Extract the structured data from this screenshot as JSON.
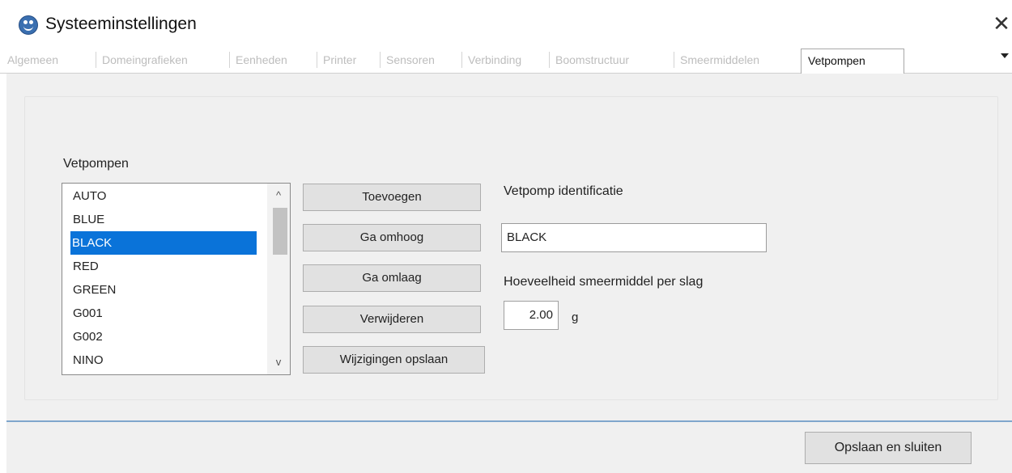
{
  "window": {
    "title": "Systeeminstellingen",
    "close_label": "✕"
  },
  "tabs": [
    {
      "label": "Algemeen"
    },
    {
      "label": "Domeingrafieken"
    },
    {
      "label": "Eenheden"
    },
    {
      "label": "Printer"
    },
    {
      "label": "Sensoren"
    },
    {
      "label": "Verbinding"
    },
    {
      "label": "Boomstructuur"
    },
    {
      "label": "Smeermiddelen"
    },
    {
      "label": "Vetpompen",
      "active": true
    }
  ],
  "vetpompen": {
    "list_label": "Vetpompen",
    "items": [
      "AUTO",
      "BLUE",
      "BLACK",
      "RED",
      "GREEN",
      "G001",
      "G002",
      "NINO"
    ],
    "selected": "BLACK",
    "scroll_up": "^",
    "scroll_down": "v"
  },
  "buttons": {
    "add": "Toevoegen",
    "move_up": "Ga omhoog",
    "move_down": "Ga omlaag",
    "delete": "Verwijderen",
    "save_changes": "Wijzigingen opslaan"
  },
  "form": {
    "id_label": "Vetpomp identificatie",
    "id_value": "BLACK",
    "amount_label": "Hoeveelheid smeermiddel per slag",
    "amount_value": "2.00",
    "amount_unit": "g"
  },
  "footer": {
    "save_close": "Opslaan en sluiten"
  },
  "colors": {
    "selection": "#0a73d9",
    "divider": "#7fa6cc",
    "panel": "#f0f0f0"
  }
}
